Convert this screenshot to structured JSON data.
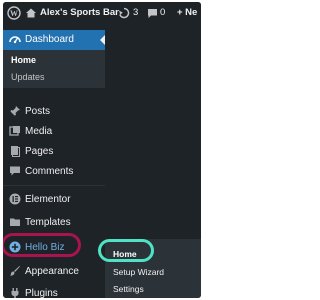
{
  "adminbar": {
    "site_title": "Alex's Sports Bar",
    "updates_count": "3",
    "comments_count": "0",
    "new_label": "+ Ne"
  },
  "menu": {
    "dashboard": "Dashboard",
    "dashboard_sub": [
      "Home",
      "Updates"
    ],
    "items": [
      "Posts",
      "Media",
      "Pages",
      "Comments",
      "Elementor",
      "Templates",
      "Hello Biz",
      "Appearance",
      "Plugins"
    ]
  },
  "flyout": {
    "items": [
      "Home",
      "Setup Wizard",
      "Settings"
    ]
  },
  "colors": {
    "background": "#1d2327",
    "submenu_bg": "#2c3338",
    "accent": "#2271b1",
    "highlight_home": "#4fe3c5",
    "highlight_biz": "#a81450",
    "hello_biz_text": "#72aee6"
  }
}
